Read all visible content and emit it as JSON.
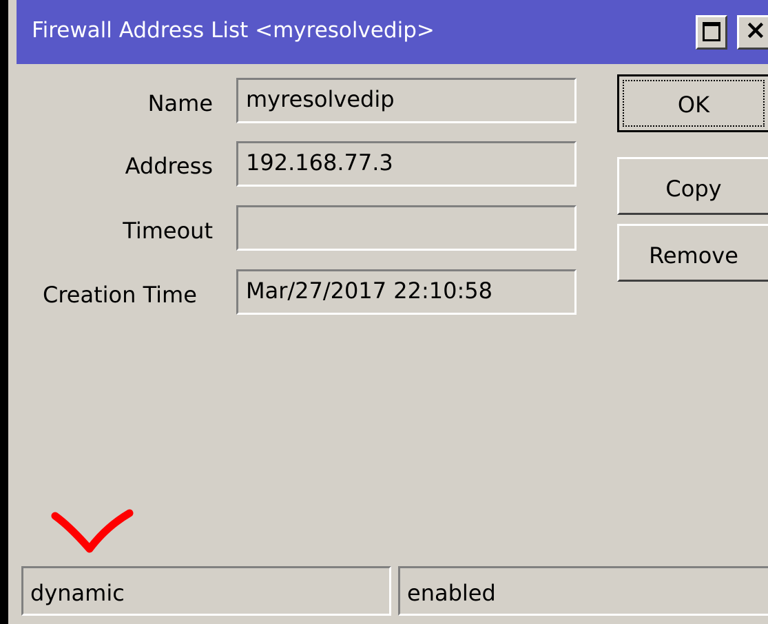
{
  "window": {
    "title": "Firewall Address List <myresolvedip>"
  },
  "form": {
    "name_label": "Name",
    "name_value": "myresolvedip",
    "address_label": "Address",
    "address_value": "192.168.77.3",
    "timeout_label": "Timeout",
    "timeout_value": "",
    "creation_time_label": "Creation Time",
    "creation_time_value": "Mar/27/2017 22:10:58"
  },
  "buttons": {
    "ok": "OK",
    "copy": "Copy",
    "remove": "Remove"
  },
  "status": {
    "left": "dynamic",
    "right": "enabled"
  },
  "icons": {
    "maximize": "maximize-icon",
    "close": "close-icon",
    "annotation": "red-checkmark-annotation"
  },
  "colors": {
    "titlebar": "#5858c8",
    "background": "#d4d0c8",
    "annotation": "#ff0000"
  }
}
